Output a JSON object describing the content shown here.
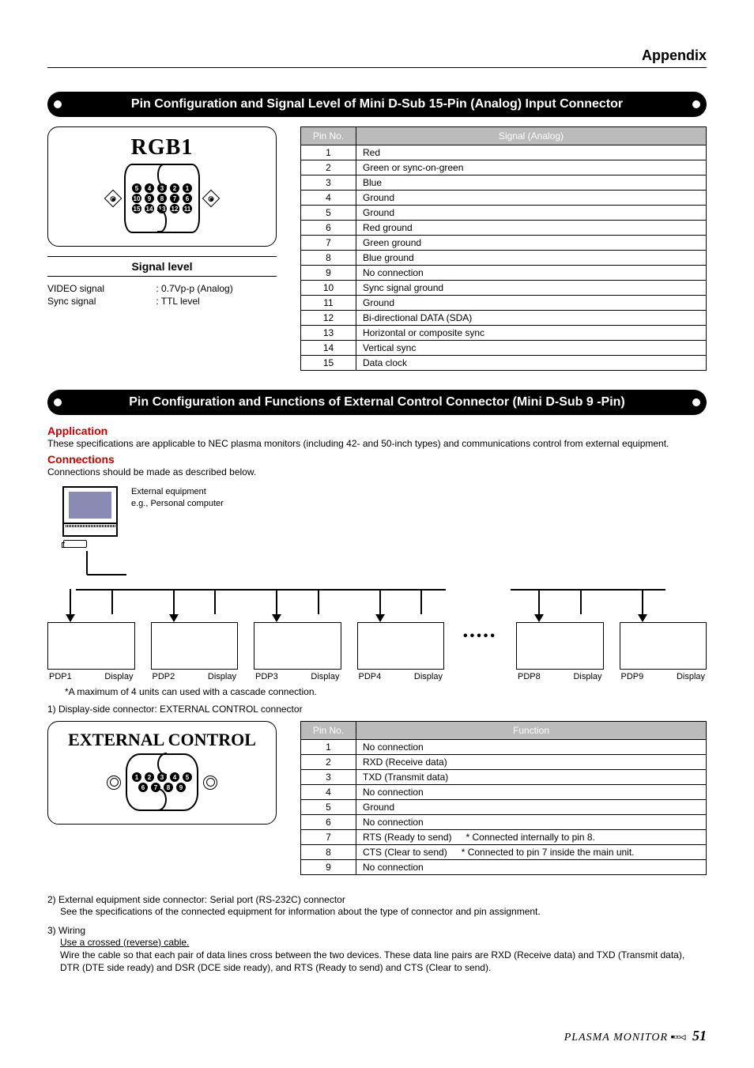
{
  "appendix": "Appendix",
  "section1_title": "Pin Configuration and Signal Level of Mini D-Sub 15-Pin (Analog) Input Connector",
  "rgb_box_title": "RGB1",
  "signal_level_title": "Signal level",
  "signal_level": {
    "video_label": "VIDEO signal",
    "video_value": ": 0.7Vp-p (Analog)",
    "sync_label": "Sync signal",
    "sync_value": ": TTL level"
  },
  "table1": {
    "headers": [
      "Pin No.",
      "Signal (Analog)"
    ],
    "rows": [
      [
        "1",
        "Red"
      ],
      [
        "2",
        "Green or sync-on-green"
      ],
      [
        "3",
        "Blue"
      ],
      [
        "4",
        "Ground"
      ],
      [
        "5",
        "Ground"
      ],
      [
        "6",
        "Red ground"
      ],
      [
        "7",
        "Green ground"
      ],
      [
        "8",
        "Blue ground"
      ],
      [
        "9",
        "No connection"
      ],
      [
        "10",
        "Sync signal ground"
      ],
      [
        "11",
        "Ground"
      ],
      [
        "12",
        "Bi-directional DATA (SDA)"
      ],
      [
        "13",
        "Horizontal or composite sync"
      ],
      [
        "14",
        "Vertical sync"
      ],
      [
        "15",
        "Data clock"
      ]
    ]
  },
  "section2_title": "Pin Configuration and Functions of External Control Connector (Mini D-Sub 9 -Pin)",
  "application_heading": "Application",
  "application_text": "These specifications are applicable to NEC plasma monitors (including 42- and 50-inch types) and communications control from external equipment.",
  "connections_heading": "Connections",
  "connections_text": "Connections should be made as described below.",
  "ext_equip_line1": "External equipment",
  "ext_equip_line2": "e.g., Personal computer",
  "pdp_units": [
    {
      "id": "PDP1",
      "disp": "Display"
    },
    {
      "id": "PDP2",
      "disp": "Display"
    },
    {
      "id": "PDP3",
      "disp": "Display"
    },
    {
      "id": "PDP4",
      "disp": "Display"
    },
    {
      "id": "PDP8",
      "disp": "Display"
    },
    {
      "id": "PDP9",
      "disp": "Display"
    }
  ],
  "cascade_note": "*A maximum of 4 units can used with a cascade connection.",
  "step1": "1) Display-side connector: EXTERNAL CONTROL connector",
  "ec_box_title": "EXTERNAL CONTROL",
  "table2": {
    "headers": [
      "Pin No.",
      "Function"
    ],
    "rows": [
      {
        "n": "1",
        "f": "No connection",
        "note": ""
      },
      {
        "n": "2",
        "f": "RXD (Receive data)",
        "note": ""
      },
      {
        "n": "3",
        "f": "TXD (Transmit data)",
        "note": ""
      },
      {
        "n": "4",
        "f": "No connection",
        "note": ""
      },
      {
        "n": "5",
        "f": "Ground",
        "note": ""
      },
      {
        "n": "6",
        "f": "No connection",
        "note": ""
      },
      {
        "n": "7",
        "f": "RTS (Ready to send)",
        "note": "* Connected internally to pin 8."
      },
      {
        "n": "8",
        "f": "CTS (Clear to send)",
        "note": "* Connected to pin 7 inside the main unit."
      },
      {
        "n": "9",
        "f": "No connection",
        "note": ""
      }
    ]
  },
  "step2": "2) External equipment side connector: Serial port (RS-232C) connector",
  "step2_text": "See the specifications of the connected equipment for information about the type of connector and pin assignment.",
  "step3": "3) Wiring",
  "step3_underline": "Use a crossed (reverse) cable.",
  "step3_text": "Wire the cable so that each pair of data lines cross between the two devices. These data line pairs are RXD (Receive data) and TXD (Transmit data), DTR (DTE side ready) and DSR (DCE side ready), and RTS (Ready to send) and CTS (Clear to send).",
  "footer_text": "PLASMA MONITOR",
  "footer_page": "51"
}
